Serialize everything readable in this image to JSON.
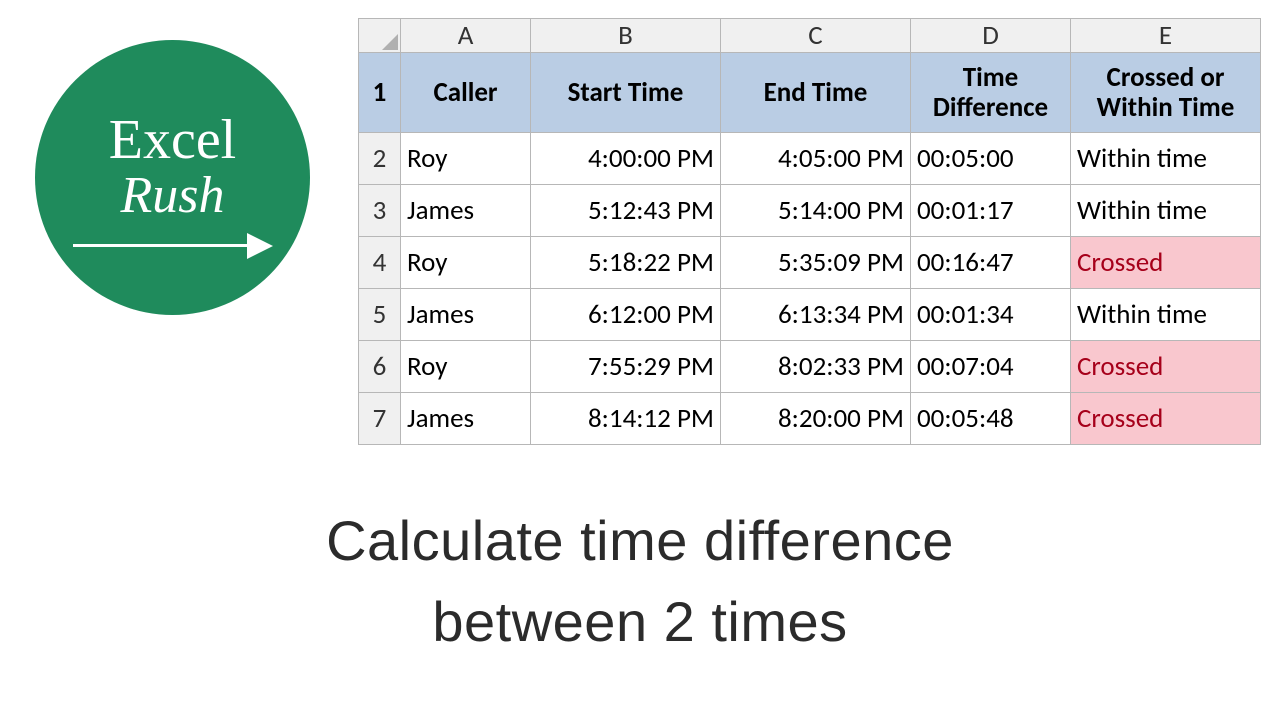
{
  "logo": {
    "line1": "Excel",
    "line2": "Rush"
  },
  "columns": [
    "A",
    "B",
    "C",
    "D",
    "E"
  ],
  "header": {
    "A": "Caller",
    "B": "Start Time",
    "C": "End Time",
    "D": "Time Difference",
    "E": "Crossed or Within Time"
  },
  "rows": [
    {
      "n": "2",
      "A": "Roy",
      "B": "4:00:00 PM",
      "C": "4:05:00 PM",
      "D": "00:05:00",
      "E": "Within time",
      "crossed": false
    },
    {
      "n": "3",
      "A": "James",
      "B": "5:12:43 PM",
      "C": "5:14:00 PM",
      "D": "00:01:17",
      "E": "Within time",
      "crossed": false
    },
    {
      "n": "4",
      "A": "Roy",
      "B": "5:18:22 PM",
      "C": "5:35:09 PM",
      "D": "00:16:47",
      "E": "Crossed",
      "crossed": true
    },
    {
      "n": "5",
      "A": "James",
      "B": "6:12:00 PM",
      "C": "6:13:34 PM",
      "D": "00:01:34",
      "E": "Within time",
      "crossed": false
    },
    {
      "n": "6",
      "A": "Roy",
      "B": "7:55:29 PM",
      "C": "8:02:33 PM",
      "D": "00:07:04",
      "E": "Crossed",
      "crossed": true
    },
    {
      "n": "7",
      "A": "James",
      "B": "8:14:12 PM",
      "C": "8:20:00 PM",
      "D": "00:05:48",
      "E": "Crossed",
      "crossed": true
    }
  ],
  "header_row_number": "1",
  "caption": {
    "line1": "Calculate time difference",
    "line2": "between 2 times"
  }
}
